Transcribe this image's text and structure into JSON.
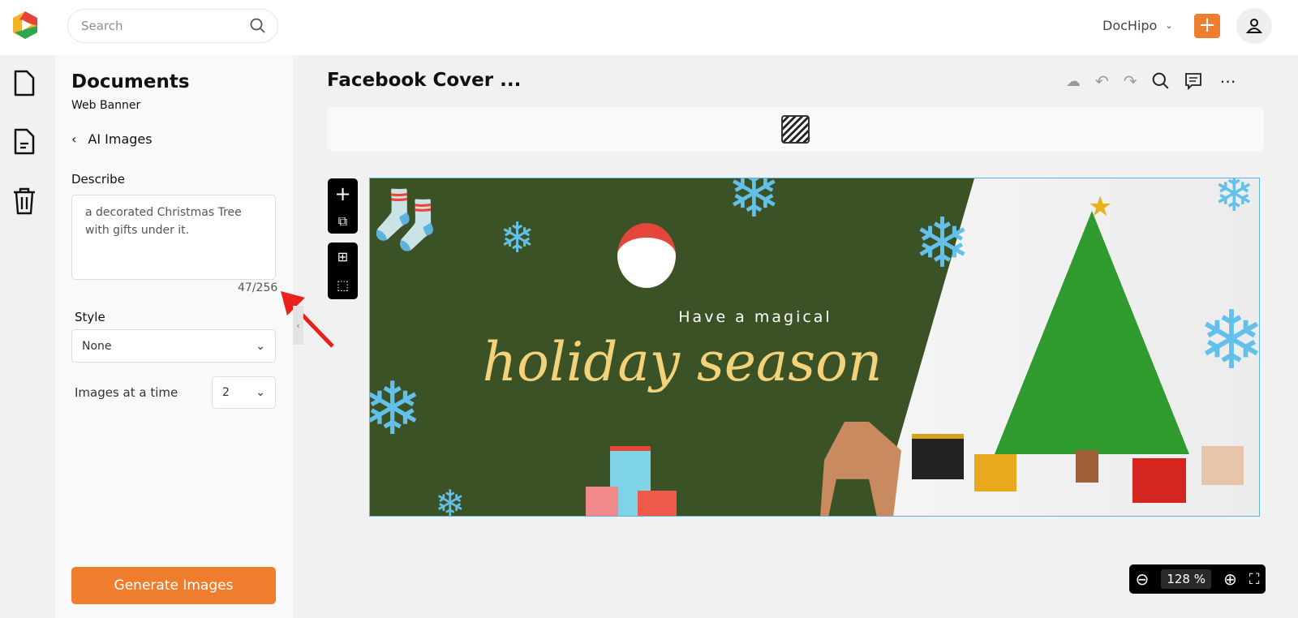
{
  "header": {
    "search_placeholder": "Search",
    "workspace": "DocHipo",
    "add_label": "+"
  },
  "sidebar": {
    "title": "Documents",
    "subtitle": "Web Banner",
    "back_label": "AI Images",
    "describe_label": "Describe",
    "describe_value": "a decorated Christmas Tree with gifts under it.",
    "char_count": "47/256",
    "style_label": "Style",
    "style_value": "None",
    "images_label": "Images at a time",
    "images_value": "2",
    "generate_label": "Generate Images"
  },
  "editor": {
    "doc_title": "Facebook Cover ...",
    "zoom_value": "128 %"
  },
  "banner": {
    "line1": "Have a magical",
    "line2": "holiday season"
  },
  "colors": {
    "accent": "#ef7d2e",
    "banner_green": "#3b5226",
    "snowflake": "#63c0ea",
    "script_text": "#f4d27a"
  }
}
